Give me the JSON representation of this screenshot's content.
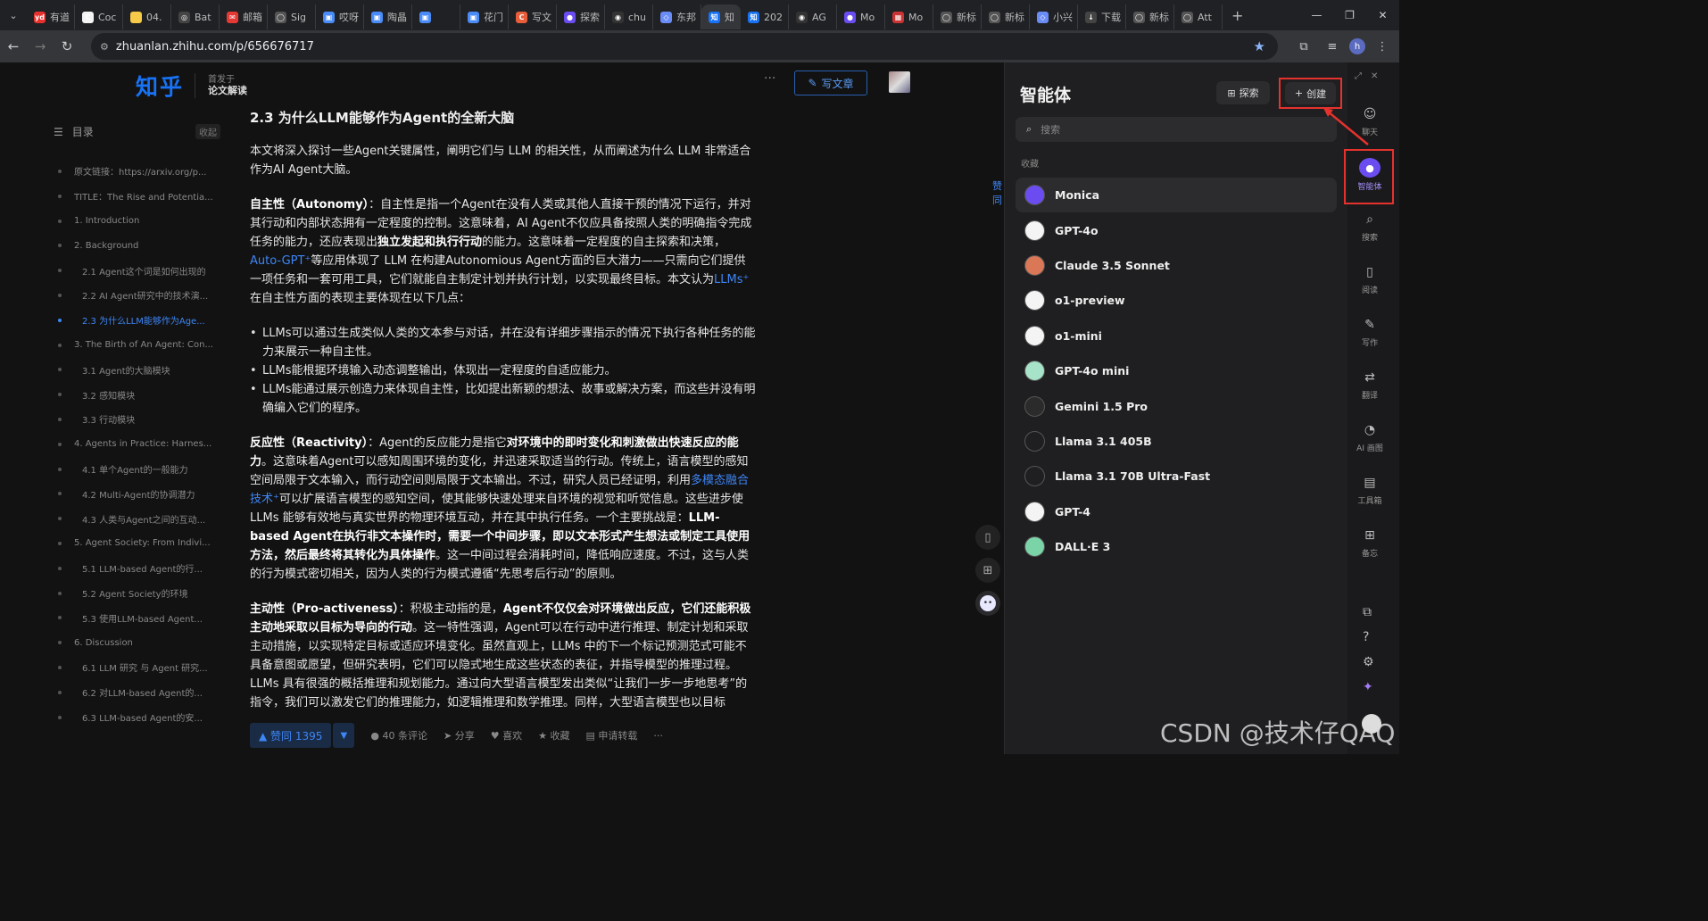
{
  "browser": {
    "tabs": [
      {
        "label": "有道",
        "icon": "yd",
        "color": "#e8302c"
      },
      {
        "label": "Coc",
        "icon": "C",
        "color": "#f4f4f4"
      },
      {
        "label": "04.",
        "icon": "",
        "color": "#f7c948"
      },
      {
        "label": "Bat",
        "icon": "◎",
        "color": "#444"
      },
      {
        "label": "邮箱",
        "icon": "✉",
        "color": "#e53935"
      },
      {
        "label": "Sig",
        "icon": "◯",
        "color": "#555"
      },
      {
        "label": "哎呀",
        "icon": "▣",
        "color": "#4a8cf7"
      },
      {
        "label": "陶晶",
        "icon": "▣",
        "color": "#4a8cf7"
      },
      {
        "label": "",
        "icon": "▣",
        "color": "#4a8cf7"
      },
      {
        "label": "花门",
        "icon": "▣",
        "color": "#4a8cf7"
      },
      {
        "label": "写文",
        "icon": "C",
        "color": "#e85d3a"
      },
      {
        "label": "探索",
        "icon": "●",
        "color": "#6a4cf0"
      },
      {
        "label": "chu",
        "icon": "◉",
        "color": "#333"
      },
      {
        "label": "东邦",
        "icon": "◇",
        "color": "#6a8cf7"
      },
      {
        "label": "知",
        "icon": "知",
        "color": "#1772f6"
      },
      {
        "label": "202",
        "icon": "知",
        "color": "#1772f6"
      },
      {
        "label": "AG",
        "icon": "◉",
        "color": "#333"
      },
      {
        "label": "Mo",
        "icon": "●",
        "color": "#6a4cf0"
      },
      {
        "label": "Mo",
        "icon": "▦",
        "color": "#c33"
      },
      {
        "label": "新标",
        "icon": "◯",
        "color": "#555"
      },
      {
        "label": "新标",
        "icon": "◯",
        "color": "#555"
      },
      {
        "label": "小兴",
        "icon": "◇",
        "color": "#6a8cf7"
      },
      {
        "label": "下载",
        "icon": "↓",
        "color": "#444"
      },
      {
        "label": "新标",
        "icon": "◯",
        "color": "#555"
      },
      {
        "label": "Att",
        "icon": "◯",
        "color": "#555"
      }
    ],
    "active_tab_index": 14,
    "url": "zhuanlan.zhihu.com/p/656676717",
    "profile_letter": "h"
  },
  "zhihu": {
    "logo": "知乎",
    "published_in_label": "首发于",
    "column_name": "论文解读",
    "write_button": "写文章",
    "toc_title": "目录",
    "toc_collapse": "收起",
    "toc": [
      {
        "text": "原文链接：https://arxiv.org/p...",
        "sub": false,
        "active": false
      },
      {
        "text": "TITLE：The Rise and Potentia...",
        "sub": false,
        "active": false
      },
      {
        "text": "1. Introduction",
        "sub": false,
        "active": false
      },
      {
        "text": "2. Background",
        "sub": false,
        "active": false
      },
      {
        "text": "2.1 Agent这个词是如何出现的",
        "sub": true,
        "active": false
      },
      {
        "text": "2.2 AI Agent研究中的技术演...",
        "sub": true,
        "active": false
      },
      {
        "text": "2.3 为什么LLM能够作为Age...",
        "sub": true,
        "active": true
      },
      {
        "text": "3. The Birth of An Agent: Con...",
        "sub": false,
        "active": false
      },
      {
        "text": "3.1 Agent的大脑模块",
        "sub": true,
        "active": false
      },
      {
        "text": "3.2 感知模块",
        "sub": true,
        "active": false
      },
      {
        "text": "3.3 行动模块",
        "sub": true,
        "active": false
      },
      {
        "text": "4. Agents in Practice: Harnes...",
        "sub": false,
        "active": false
      },
      {
        "text": "4.1 单个Agent的一般能力",
        "sub": true,
        "active": false
      },
      {
        "text": "4.2 Multi-Agent的协调潜力",
        "sub": true,
        "active": false
      },
      {
        "text": "4.3 人类与Agent之间的互动...",
        "sub": true,
        "active": false
      },
      {
        "text": "5. Agent Society: From Indivi...",
        "sub": false,
        "active": false
      },
      {
        "text": "5.1 LLM-based Agent的行...",
        "sub": true,
        "active": false
      },
      {
        "text": "5.2 Agent Society的环境",
        "sub": true,
        "active": false
      },
      {
        "text": "5.3 使用LLM-based Agent...",
        "sub": true,
        "active": false
      },
      {
        "text": "6. Discussion",
        "sub": false,
        "active": false
      },
      {
        "text": "6.1 LLM 研究 与 Agent 研究...",
        "sub": true,
        "active": false
      },
      {
        "text": "6.2 对LLM-based Agent的...",
        "sub": true,
        "active": false
      },
      {
        "text": "6.3 LLM-based Agent的安...",
        "sub": true,
        "active": false
      }
    ],
    "article": {
      "heading": "2.3 为什么LLM能够作为Agent的全新大脑",
      "intro": "本文将深入探讨一些Agent关键属性，阐明它们与 LLM 的相关性，从而阐述为什么 LLM 非常适合作为AI Agent大脑。",
      "autonomy_term": "自主性（Autonomy）",
      "autonomy_a": "：自主性是指一个Agent在没有人类或其他人直接干预的情况下运行，并对其行动和内部状态拥有一定程度的控制。这意味着，AI Agent不仅应具备按照人类的明确指令完成任务的能力，还应表现出",
      "autonomy_bold": "独立发起和执行行动",
      "autonomy_b": "的能力。这意味着一定程度的自主探索和决策，",
      "autonomy_link1": "Auto-GPT⁺",
      "autonomy_c": "等应用体现了 LLM 在构建Autonomious Agent方面的巨大潜力——只需向它们提供一项任务和一套可用工具，它们就能自主制定计划并执行计划，以实现最终目标。本文认为",
      "autonomy_link2": "LLMs⁺",
      "autonomy_d": "在自主性方面的表现主要体现在以下几点：",
      "bullets": [
        "LLMs可以通过生成类似人类的文本参与对话，并在没有详细步骤指示的情况下执行各种任务的能力来展示一种自主性。",
        "LLMs能根据环境输入动态调整输出，体现出一定程度的自适应能力。",
        "LLMs能通过展示创造力来体现自主性，比如提出新颖的想法、故事或解决方案，而这些并没有明确编入它们的程序。"
      ],
      "reactivity_term": "反应性（Reactivity）",
      "reactivity_a": "：Agent的反应能力是指它",
      "reactivity_bold1": "对环境中的即时变化和刺激做出快速反应的能力",
      "reactivity_b": "。这意味着Agent可以感知周围环境的变化，并迅速采取适当的行动。传统上，语言模型的感知空间局限于文本输入，而行动空间则局限于文本输出。不过，研究人员已经证明，利用",
      "reactivity_link": "多模态融合技术⁺",
      "reactivity_c": "可以扩展语言模型的感知空间，使其能够快速处理来自环境的视觉和听觉信息。这些进步使 LLMs 能够有效地与真实世界的物理环境互动，并在其中执行任务。一个主要挑战是：",
      "reactivity_bold2": "LLM-based Agent在执行非文本操作时，需要一个中间步骤，即以文本形式产生想法或制定工具使用方法，然后最终将其转化为具体操作",
      "reactivity_d": "。这一中间过程会消耗时间，降低响应速度。不过，这与人类的行为模式密切相关，因为人类的行为模式遵循“先思考后行动”的原则。",
      "pro_term": "主动性（Pro-activeness）",
      "pro_a": "：积极主动指的是，",
      "pro_bold": "Agent不仅仅会对环境做出反应，它们还能积极主动地采取以目标为导向的行动",
      "pro_b": "。这一特性强调，Agent可以在行动中进行推理、制定计划和采取主动措施，以实现特定目标或适应环境变化。虽然直观上，LLMs 中的下一个标记预测范式可能不具备意图或愿望，但研究表明，它们可以隐式地生成这些状态的表征，并指导模型的推理过程。LLMs 具有很强的概括推理和规划能力。通过向大型语言模型发出类似“让我们一步一步地思考”的指令，我们可以激发它们的推理能力，如逻辑推理和数学推理。同样，大型语言模型也以目标"
    },
    "actions": {
      "vote": "▲ 赞同 1395",
      "vote_down": "▼",
      "comments": "40 条评论",
      "share": "分享",
      "like": "喜欢",
      "collect": "收藏",
      "repost": "申请转载",
      "more": "···"
    },
    "side_label": "赞同"
  },
  "monica": {
    "title": "智能体",
    "explore": "探索",
    "create": "创建",
    "search_placeholder": "搜索",
    "favorites_label": "收藏",
    "bots": [
      {
        "name": "Monica",
        "color": "#6a4cf0",
        "selected": true
      },
      {
        "name": "GPT-4o",
        "color": "#f4f4f4",
        "selected": false
      },
      {
        "name": "Claude 3.5 Sonnet",
        "color": "#d97757",
        "selected": false
      },
      {
        "name": "o1-preview",
        "color": "#f4f4f4",
        "selected": false
      },
      {
        "name": "o1-mini",
        "color": "#f4f4f4",
        "selected": false
      },
      {
        "name": "GPT-4o mini",
        "color": "#a7e3c8",
        "selected": false
      },
      {
        "name": "Gemini 1.5 Pro",
        "color": "#2b2b2b",
        "selected": false
      },
      {
        "name": "Llama 3.1 405B",
        "color": "#1f1f21",
        "selected": false
      },
      {
        "name": "Llama 3.1 70B Ultra-Fast",
        "color": "#1f1f21",
        "selected": false
      },
      {
        "name": "GPT-4",
        "color": "#f4f4f4",
        "selected": false
      },
      {
        "name": "DALL·E 3",
        "color": "#7bd4a8",
        "selected": false
      }
    ],
    "rail": [
      {
        "label": "聊天",
        "icon": "☺"
      },
      {
        "label": "智能体",
        "icon": "●"
      },
      {
        "label": "搜索",
        "icon": "⌕"
      },
      {
        "label": "阅读",
        "icon": "▯"
      },
      {
        "label": "写作",
        "icon": "✎"
      },
      {
        "label": "翻译",
        "icon": "⇄"
      },
      {
        "label": "AI 画图",
        "icon": "◔"
      },
      {
        "label": "工具箱",
        "icon": "▤"
      },
      {
        "label": "备忘",
        "icon": "⊞"
      }
    ]
  },
  "watermark": "CSDN @技术仔QAQ"
}
